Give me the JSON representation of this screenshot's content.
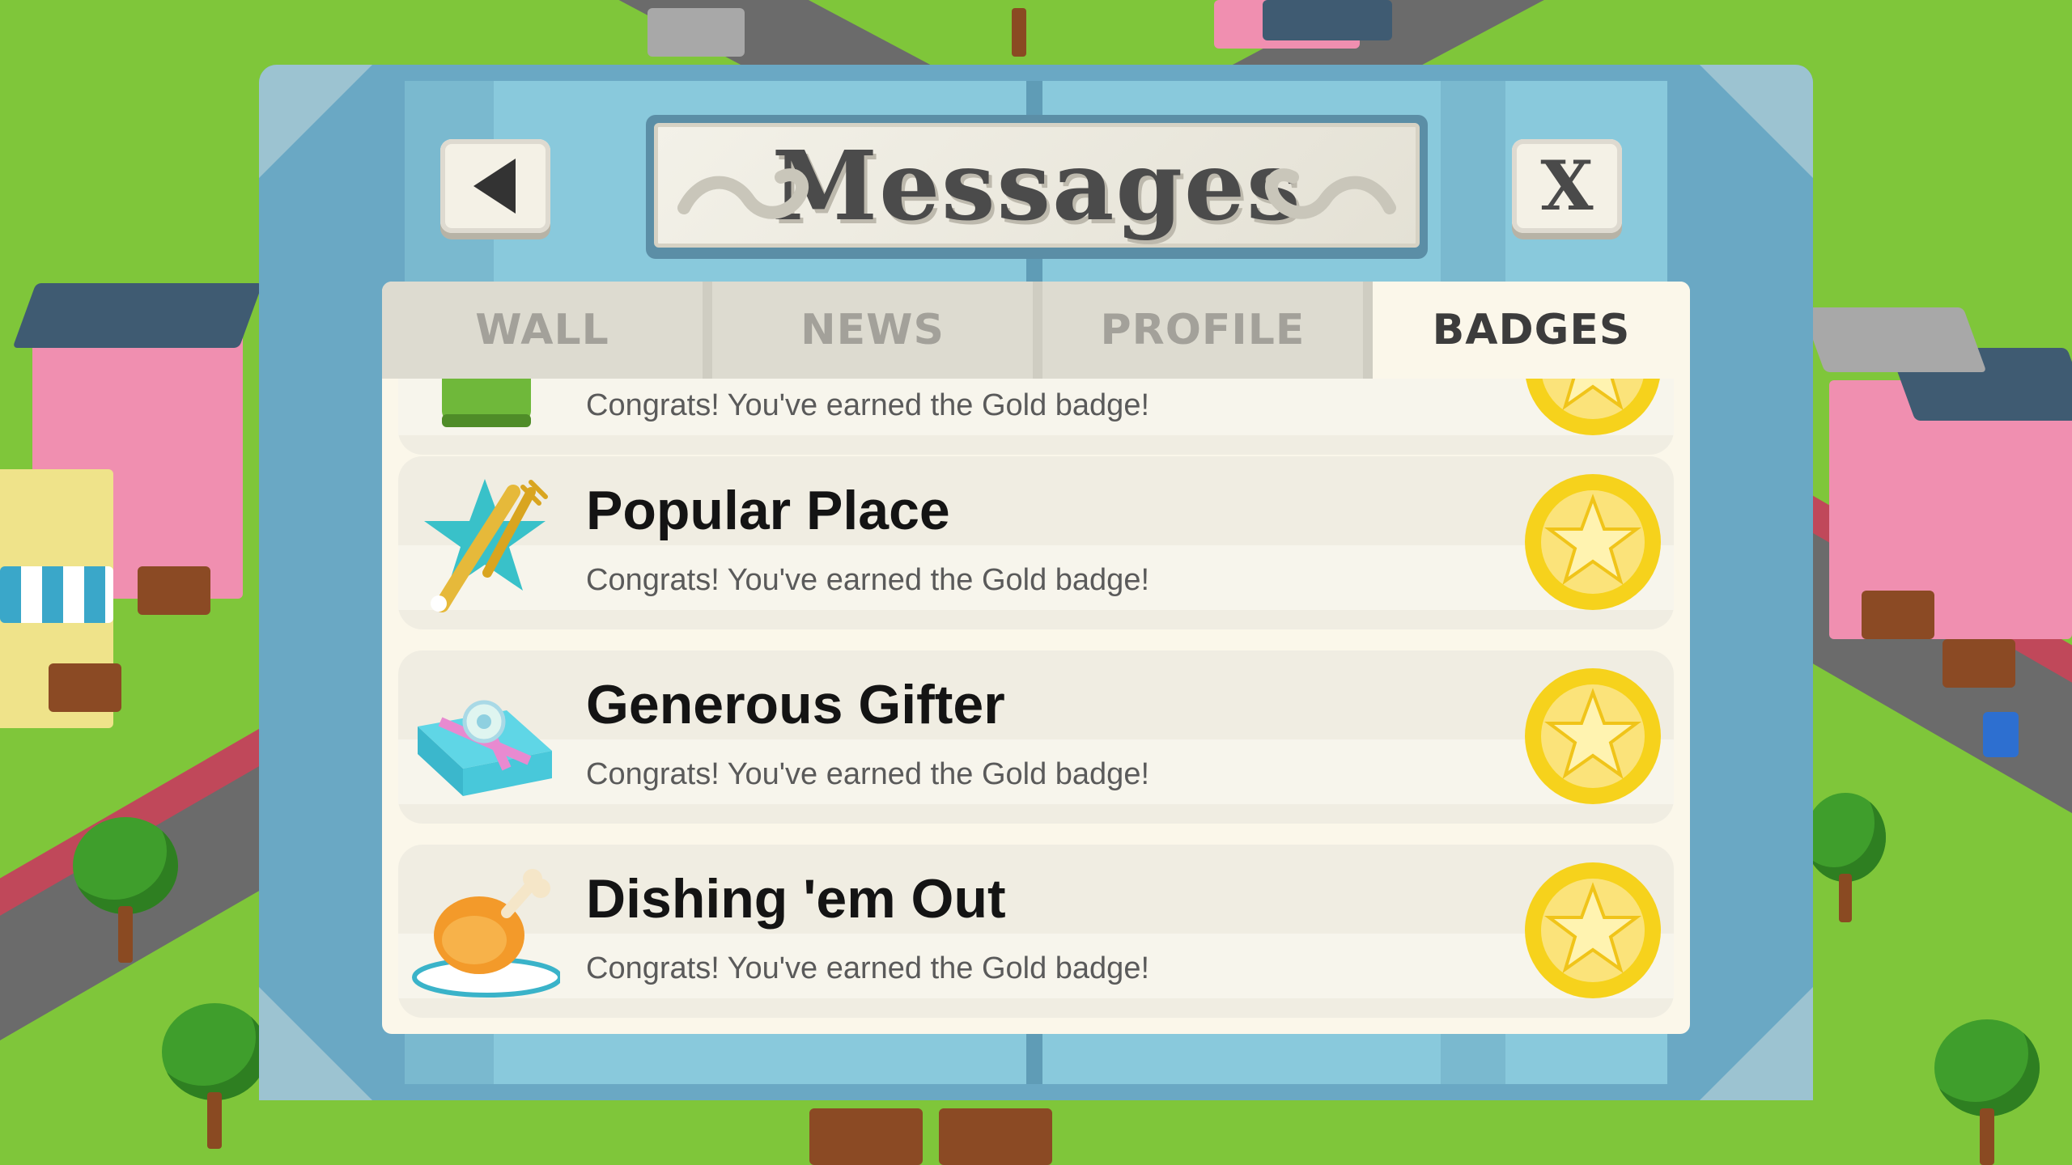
{
  "dialog": {
    "title": "Messages",
    "back_button_icon": "back-arrow-icon",
    "close_label": "X"
  },
  "tabs": [
    {
      "label": "WALL",
      "active": false
    },
    {
      "label": "NEWS",
      "active": false
    },
    {
      "label": "PROFILE",
      "active": false
    },
    {
      "label": "BADGES",
      "active": true
    }
  ],
  "badges": [
    {
      "title": "",
      "desc": "Congrats! You've earned the Gold badge!",
      "icon": "green-item-icon",
      "badge": "gold-star-badge-icon"
    },
    {
      "title": "Popular Place",
      "desc": "Congrats! You've earned the Gold badge!",
      "icon": "star-fork-knife-icon",
      "badge": "gold-star-badge-icon"
    },
    {
      "title": "Generous Gifter",
      "desc": "Congrats! You've earned the Gold badge!",
      "icon": "gift-box-icon",
      "badge": "gold-star-badge-icon"
    },
    {
      "title": "Dishing 'em Out",
      "desc": "Congrats! You've earned the Gold badge!",
      "icon": "chicken-leg-plate-icon",
      "badge": "gold-star-badge-icon"
    }
  ],
  "colors": {
    "frame": "#6aa8c4",
    "panel": "#fbf7ea",
    "gold": "#f6d21c",
    "grass": "#7fc63a"
  }
}
